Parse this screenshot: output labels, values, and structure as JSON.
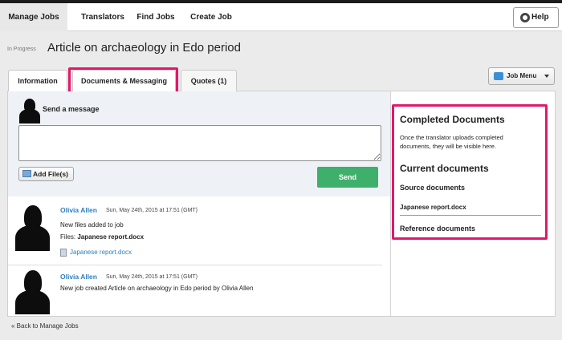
{
  "nav": {
    "items": [
      {
        "label": "Manage Jobs"
      },
      {
        "label": "Translators"
      },
      {
        "label": "Find Jobs"
      },
      {
        "label": "Create Job"
      }
    ],
    "help_label": "Help"
  },
  "job": {
    "status": "In Progress",
    "title": "Article on archaeology in Edo period"
  },
  "tabs": [
    {
      "label": "Information"
    },
    {
      "label": "Documents & Messaging"
    },
    {
      "label": "Quotes (1)"
    }
  ],
  "job_menu_label": "Job Menu",
  "compose": {
    "heading": "Send a message",
    "message_value": "",
    "add_file_label": "Add File(s)",
    "send_label": "Send"
  },
  "messages": [
    {
      "author": "Olivia Allen",
      "time": "Sun, May 24th, 2015 at 17:51 (GMT)",
      "text": "New files added to job",
      "files_label": "Files:",
      "files_value": "Japanese report.docx",
      "file_link": "Japanese report.docx"
    },
    {
      "author": "Olivia Allen",
      "time": "Sun, May 24th, 2015 at 17:51 (GMT)",
      "text": "New job created Article on archaeology in Edo period by Olivia Allen"
    }
  ],
  "right_panel": {
    "completed_title": "Completed Documents",
    "completed_desc_line1": "Once the translator uploads completed",
    "completed_desc_line2": "documents, they will be visible here.",
    "current_title": "Current documents",
    "source_title": "Source documents",
    "source_file": "Japanese report.docx",
    "reference_title": "Reference documents"
  },
  "back_link": "« Back to Manage Jobs",
  "colors": {
    "accent_highlight": "#e0196b",
    "link_blue": "#2f7fbd",
    "send_green": "#3fb06c"
  }
}
